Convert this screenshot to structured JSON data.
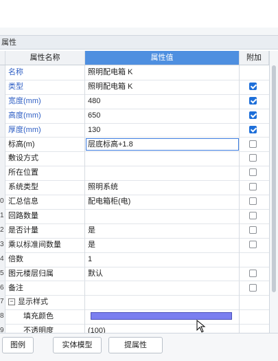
{
  "panel": {
    "title": "属性"
  },
  "columns": {
    "name": "属性名称",
    "value": "属性值",
    "add": "附加"
  },
  "rows": [
    {
      "num": "",
      "name": "名称",
      "value": "照明配电箱 K",
      "blue": true,
      "check": null
    },
    {
      "num": "",
      "name": "类型",
      "value": "照明配电箱 K",
      "blue": true,
      "check": true
    },
    {
      "num": "",
      "name": "宽度(mm)",
      "value": "480",
      "blue": true,
      "check": true
    },
    {
      "num": "",
      "name": "高度(mm)",
      "value": "650",
      "blue": true,
      "check": true
    },
    {
      "num": "",
      "name": "厚度(mm)",
      "value": "130",
      "blue": true,
      "check": true
    },
    {
      "num": "",
      "name": "标高(m)",
      "value": "层底标高+1.8",
      "blue": false,
      "check": false,
      "editing": true
    },
    {
      "num": "",
      "name": "敷设方式",
      "value": "",
      "blue": false,
      "check": false
    },
    {
      "num": "",
      "name": "所在位置",
      "value": "",
      "blue": false,
      "check": false
    },
    {
      "num": "",
      "name": "系统类型",
      "value": "照明系统",
      "blue": false,
      "check": false
    },
    {
      "num": "0",
      "name": "汇总信息",
      "value": "配电箱柜(电)",
      "blue": false,
      "check": false
    },
    {
      "num": "1",
      "name": "回路数量",
      "value": "",
      "blue": false,
      "check": false
    },
    {
      "num": "2",
      "name": "是否计量",
      "value": "是",
      "blue": false,
      "check": false
    },
    {
      "num": "3",
      "name": "乘以标准间数量",
      "value": "是",
      "blue": false,
      "check": false
    },
    {
      "num": "4",
      "name": "倍数",
      "value": "1",
      "blue": false,
      "check": null
    },
    {
      "num": "5",
      "name": "图元楼层归属",
      "value": "默认",
      "blue": false,
      "check": false
    },
    {
      "num": "6",
      "name": "备注",
      "value": "",
      "blue": false,
      "check": false
    },
    {
      "num": "7",
      "name": "显示样式",
      "value": "",
      "blue": false,
      "check": null,
      "expander": "−"
    },
    {
      "num": "8",
      "name": "填充颜色",
      "value": "",
      "blue": false,
      "check": null,
      "indent": true,
      "color": "#7b7ff0"
    },
    {
      "num": "9",
      "name": "不透明度",
      "value": "(100)",
      "blue": false,
      "check": null,
      "indent": true
    }
  ],
  "buttons": {
    "legend": "图例",
    "solid": "实体模型",
    "extract": "提属性"
  },
  "colors": {
    "header_value_bg": "#4e8fe0",
    "blue_label": "#2f5fc4",
    "checkbox_on": "#1e6fd9"
  }
}
